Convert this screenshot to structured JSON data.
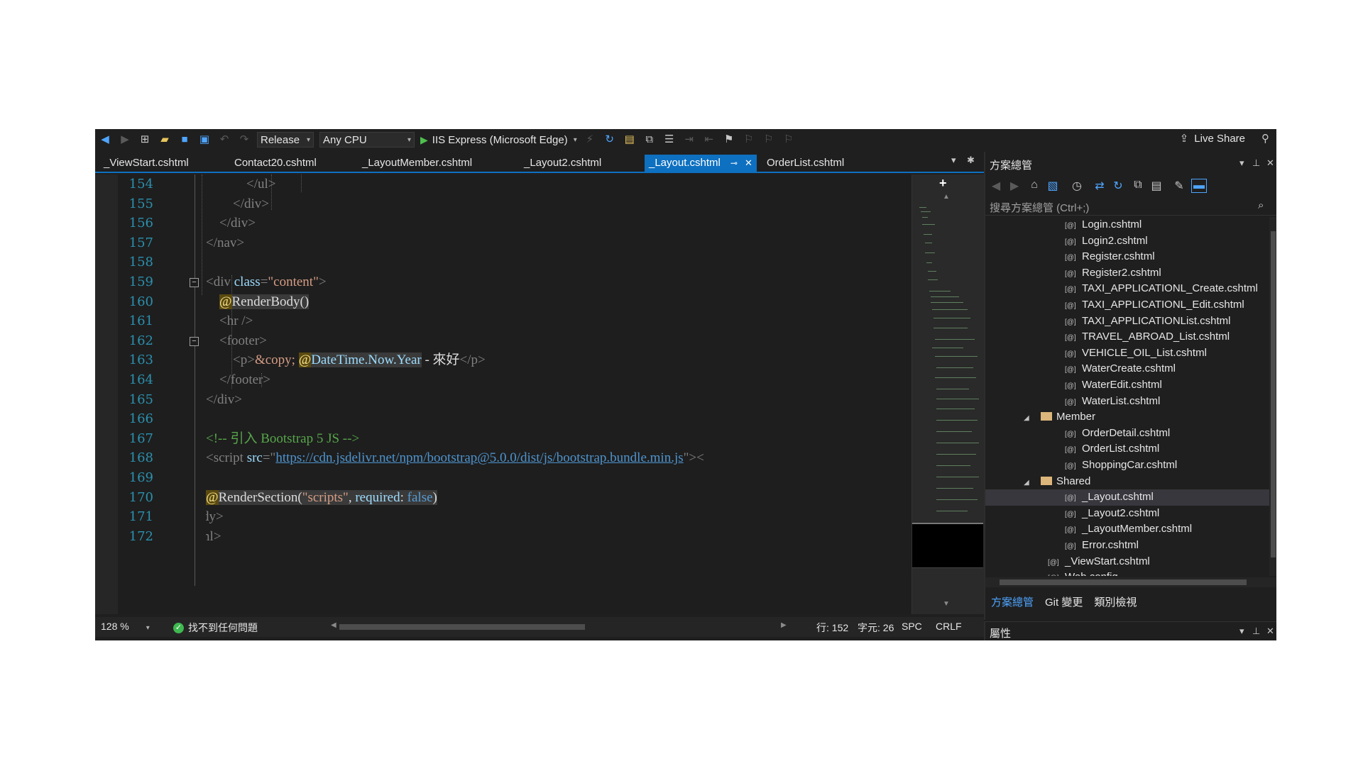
{
  "toolbar": {
    "configuration": "Release",
    "platform": "Any CPU",
    "run_target": "IIS Express (Microsoft Edge)",
    "live_share": "Live Share"
  },
  "tabs": [
    {
      "label": "_ViewStart.cshtml",
      "active": false
    },
    {
      "label": "Contact20.cshtml",
      "active": false
    },
    {
      "label": "_LayoutMember.cshtml",
      "active": false
    },
    {
      "label": "_Layout2.cshtml",
      "active": false
    },
    {
      "label": "_Layout.cshtml",
      "active": true
    },
    {
      "label": "OrderList.cshtml",
      "active": false
    }
  ],
  "editor": {
    "line_numbers": [
      "154",
      "155",
      "156",
      "157",
      "158",
      "159",
      "160",
      "161",
      "162",
      "163",
      "164",
      "165",
      "166",
      "167",
      "168",
      "169",
      "170",
      "171",
      "172"
    ],
    "code": {
      "l154_tag": "</ul>",
      "l155_tag": "</div>",
      "l156_tag": "</div>",
      "l157_tag": "</nav>",
      "l159_open": "<div ",
      "l159_attr": "class",
      "l159_eq": "=",
      "l159_val": "\"content\"",
      "l159_close": ">",
      "l160_at": "@",
      "l160_call": "RenderBody()",
      "l161_tag": "<hr />",
      "l162_tag": "<footer>",
      "l163_open": "<p>",
      "l163_entity": "&copy;",
      "l163_sp": " ",
      "l163_at": "@",
      "l163_expr": "DateTime.Now.Year",
      "l163_text": " - 來好",
      "l163_close": "</p>",
      "l164_tag": "</footer>",
      "l165_tag": "</div>",
      "l167_comment": "<!-- 引入 Bootstrap 5 JS -->",
      "l168_open": "<script ",
      "l168_attr": "src",
      "l168_eq": "=\"",
      "l168_url": "https://cdn.jsdelivr.net/npm/bootstrap@5.0.0/dist/js/bootstrap.bundle.min.js",
      "l168_close": "\"><",
      "l170_at": "@",
      "l170_call": "RenderSection(",
      "l170_str": "\"scripts\"",
      "l170_comma": ", ",
      "l170_param": "required",
      "l170_colon": ": ",
      "l170_false": "false",
      "l170_end": ")",
      "l171_tag": "</body>",
      "l172_tag": "</html>"
    }
  },
  "status": {
    "zoom": "128 %",
    "issues": "找不到任何問題",
    "line": "行: 152",
    "char": "字元: 26",
    "whitespace": "SPC",
    "eol": "CRLF"
  },
  "solution_explorer": {
    "title": "方案總管",
    "search_placeholder": "搜尋方案總管 (Ctrl+;)",
    "items": [
      {
        "label": "Login.cshtml",
        "type": "file",
        "indent": 2
      },
      {
        "label": "Login2.cshtml",
        "type": "file",
        "indent": 2
      },
      {
        "label": "Register.cshtml",
        "type": "file",
        "indent": 2
      },
      {
        "label": "Register2.cshtml",
        "type": "file",
        "indent": 2
      },
      {
        "label": "TAXI_APPLICATIONL_Create.cshtml",
        "type": "file",
        "indent": 2
      },
      {
        "label": "TAXI_APPLICATIONL_Edit.cshtml",
        "type": "file",
        "indent": 2
      },
      {
        "label": "TAXI_APPLICATIONList.cshtml",
        "type": "file",
        "indent": 2
      },
      {
        "label": "TRAVEL_ABROAD_List.cshtml",
        "type": "file",
        "indent": 2
      },
      {
        "label": "VEHICLE_OIL_List.cshtml",
        "type": "file",
        "indent": 2
      },
      {
        "label": "WaterCreate.cshtml",
        "type": "file",
        "indent": 2
      },
      {
        "label": "WaterEdit.cshtml",
        "type": "file",
        "indent": 2
      },
      {
        "label": "WaterList.cshtml",
        "type": "file",
        "indent": 2
      },
      {
        "label": "Member",
        "type": "folder",
        "indent": 1
      },
      {
        "label": "OrderDetail.cshtml",
        "type": "file",
        "indent": 2
      },
      {
        "label": "OrderList.cshtml",
        "type": "file",
        "indent": 2
      },
      {
        "label": "ShoppingCar.cshtml",
        "type": "file",
        "indent": 2
      },
      {
        "label": "Shared",
        "type": "folder",
        "indent": 1
      },
      {
        "label": "_Layout.cshtml",
        "type": "file",
        "indent": 2,
        "selected": true
      },
      {
        "label": "_Layout2.cshtml",
        "type": "file",
        "indent": 2
      },
      {
        "label": "_LayoutMember.cshtml",
        "type": "file",
        "indent": 2
      },
      {
        "label": "Error.cshtml",
        "type": "file",
        "indent": 2
      },
      {
        "label": "_ViewStart.cshtml",
        "type": "file",
        "indent": 1
      },
      {
        "label": "Web.config",
        "type": "file",
        "indent": 1
      }
    ],
    "bottom_tabs": [
      "方案總管",
      "Git 變更",
      "類別檢視"
    ]
  },
  "properties": {
    "title": "屬性"
  },
  "colors": {
    "accent": "#0e70c0",
    "ide_background": "#1f1f1f",
    "editor_background": "#1e1e1e",
    "line_number": "#2b91af"
  },
  "icons": [
    "back-icon",
    "forward-icon",
    "new-project-icon",
    "open-folder-icon",
    "save-icon",
    "save-all-icon",
    "undo-icon",
    "redo-icon",
    "play-icon",
    "refresh-icon",
    "bookmark-icon",
    "live-share-icon",
    "feedback-icon",
    "pin-icon",
    "close-icon",
    "add-icon",
    "home-icon",
    "sync-icon",
    "wrench-icon",
    "search-icon",
    "check-icon",
    "folder-icon",
    "file-icon"
  ]
}
